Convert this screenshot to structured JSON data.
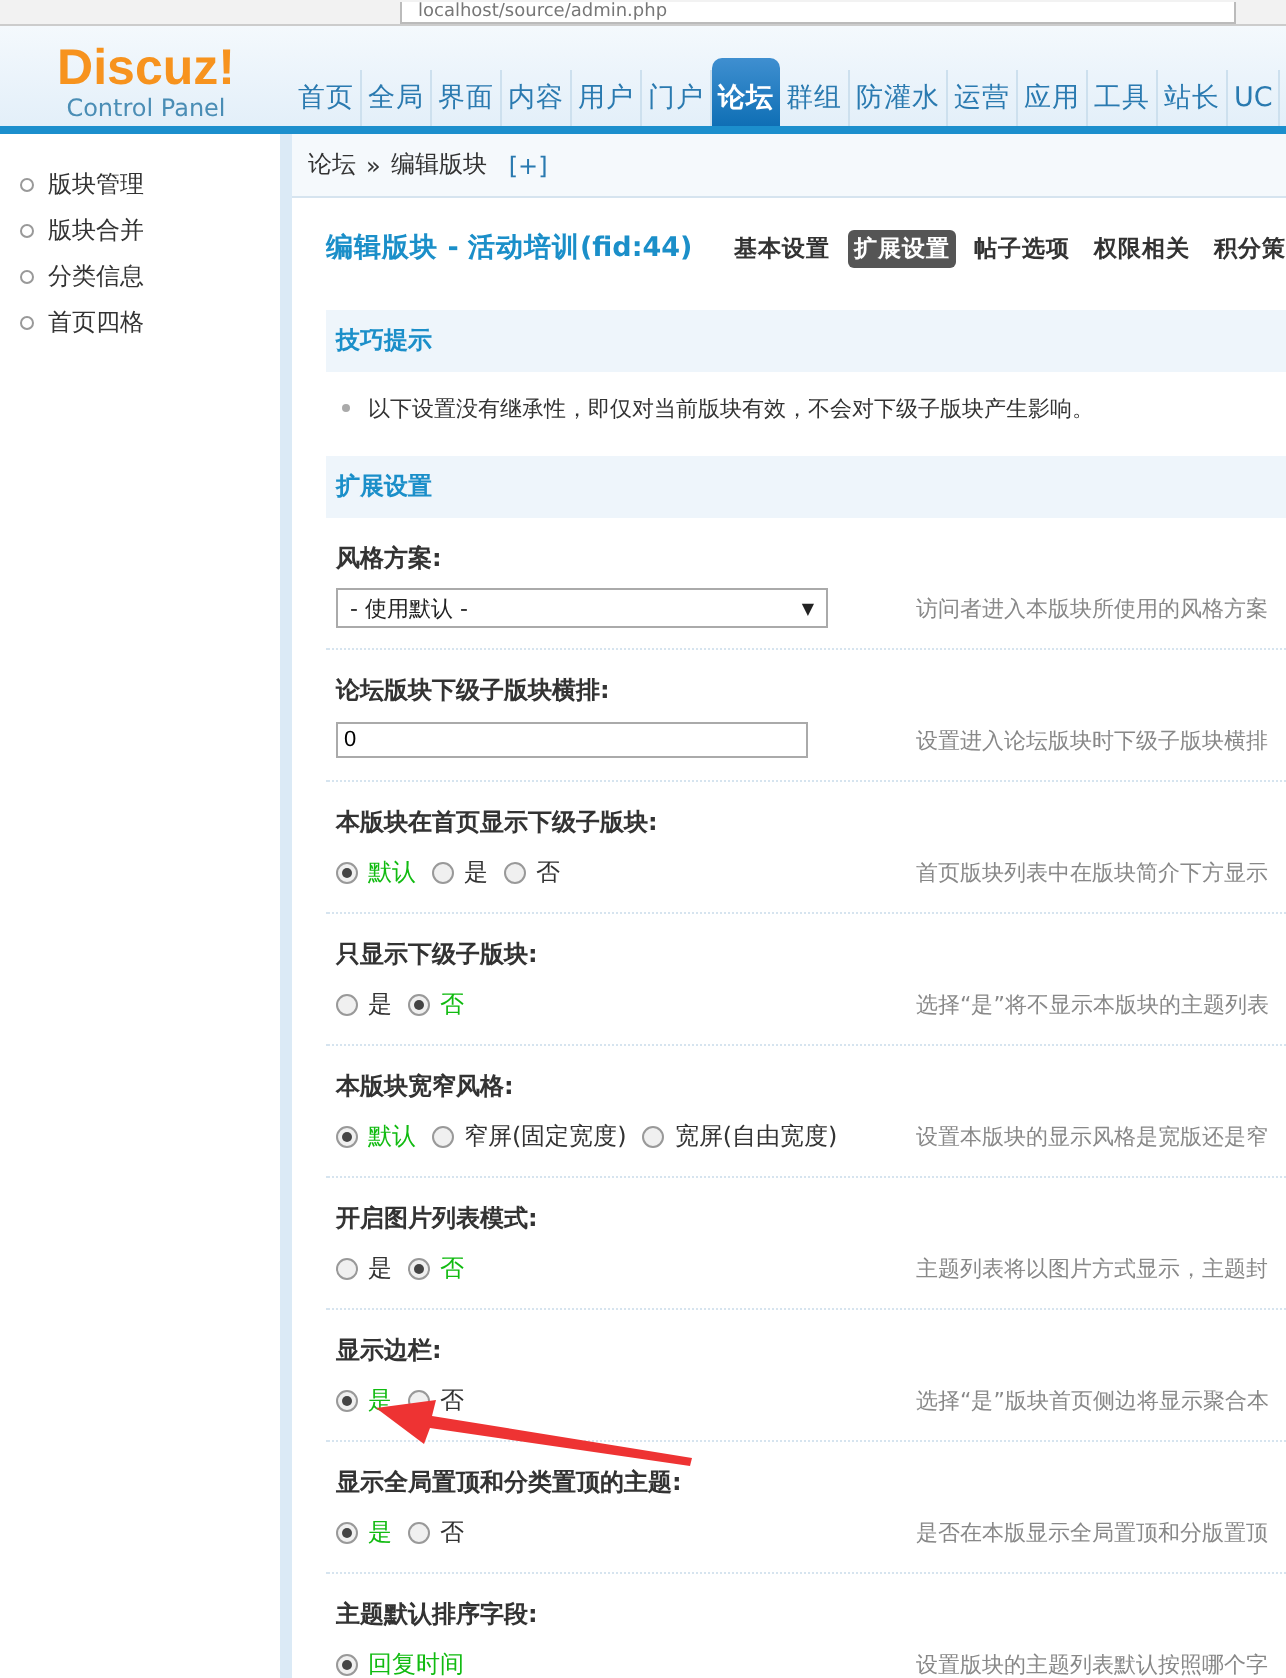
{
  "browser": {
    "url": "localhost/source/admin.php"
  },
  "logo": {
    "title": "Discuz!",
    "subtitle": "Control Panel"
  },
  "nav": [
    {
      "label": "首页",
      "selected": false
    },
    {
      "label": "全局",
      "selected": false
    },
    {
      "label": "界面",
      "selected": false
    },
    {
      "label": "内容",
      "selected": false
    },
    {
      "label": "用户",
      "selected": false
    },
    {
      "label": "门户",
      "selected": false
    },
    {
      "label": "论坛",
      "selected": true
    },
    {
      "label": "群组",
      "selected": false
    },
    {
      "label": "防灌水",
      "selected": false
    },
    {
      "label": "运营",
      "selected": false
    },
    {
      "label": "应用",
      "selected": false
    },
    {
      "label": "工具",
      "selected": false
    },
    {
      "label": "站长",
      "selected": false
    },
    {
      "label": "UC",
      "selected": false
    }
  ],
  "breadcrumb": {
    "items": [
      "论坛",
      "编辑版块"
    ],
    "separator": "»",
    "add": "[+]"
  },
  "sidebar": {
    "items": [
      "版块管理",
      "版块合并",
      "分类信息",
      "首页四格"
    ]
  },
  "page_title": "编辑版块 - 活动培训(fid:44)",
  "subtabs": [
    {
      "label": "基本设置",
      "selected": false
    },
    {
      "label": "扩展设置",
      "selected": true
    },
    {
      "label": "帖子选项",
      "selected": false
    },
    {
      "label": "权限相关",
      "selected": false
    },
    {
      "label": "积分策",
      "selected": false
    }
  ],
  "tips": {
    "title": "技巧提示",
    "items": [
      "以下设置没有继承性，即仅对当前版块有效，不会对下级子版块产生影响。"
    ]
  },
  "section_title": "扩展设置",
  "settings": [
    {
      "kind": "select",
      "label": "风格方案:",
      "value": "- 使用默认 -",
      "caret": "▼",
      "hint": "访问者进入本版块所使用的风格方案"
    },
    {
      "kind": "text",
      "label": "论坛版块下级子版块横排:",
      "value": "0",
      "hint": "设置进入论坛版块时下级子版块横排"
    },
    {
      "kind": "radio",
      "label": "本版块在首页显示下级子版块:",
      "options": [
        {
          "label": "默认",
          "selected": true
        },
        {
          "label": "是",
          "selected": false
        },
        {
          "label": "否",
          "selected": false
        }
      ],
      "hint": "首页版块列表中在版块简介下方显示"
    },
    {
      "kind": "radio",
      "label": "只显示下级子版块:",
      "options": [
        {
          "label": "是",
          "selected": false
        },
        {
          "label": "否",
          "selected": true
        }
      ],
      "hint": "选择“是”将不显示本版块的主题列表"
    },
    {
      "kind": "radio",
      "label": "本版块宽窄风格:",
      "options": [
        {
          "label": "默认",
          "selected": true
        },
        {
          "label": "窄屏(固定宽度)",
          "selected": false
        },
        {
          "label": "宽屏(自由宽度)",
          "selected": false
        }
      ],
      "hint": "设置本版块的显示风格是宽版还是窄"
    },
    {
      "kind": "radio",
      "label": "开启图片列表模式:",
      "options": [
        {
          "label": "是",
          "selected": false
        },
        {
          "label": "否",
          "selected": true
        }
      ],
      "hint": "主题列表将以图片方式显示，主题封"
    },
    {
      "kind": "radio",
      "label": "显示边栏:",
      "options": [
        {
          "label": "是",
          "selected": true
        },
        {
          "label": "否",
          "selected": false
        }
      ],
      "hint": "选择“是”版块首页侧边将显示聚合本"
    },
    {
      "kind": "radio",
      "label": "显示全局置顶和分类置顶的主题:",
      "options": [
        {
          "label": "是",
          "selected": true
        },
        {
          "label": "否",
          "selected": false
        }
      ],
      "hint": "是否在本版显示全局置顶和分版置顶"
    },
    {
      "kind": "radio",
      "label": "主题默认排序字段:",
      "options": [
        {
          "label": "回复时间",
          "selected": true
        }
      ],
      "hint": "设置版块的主题列表默认按照哪个字"
    }
  ]
}
